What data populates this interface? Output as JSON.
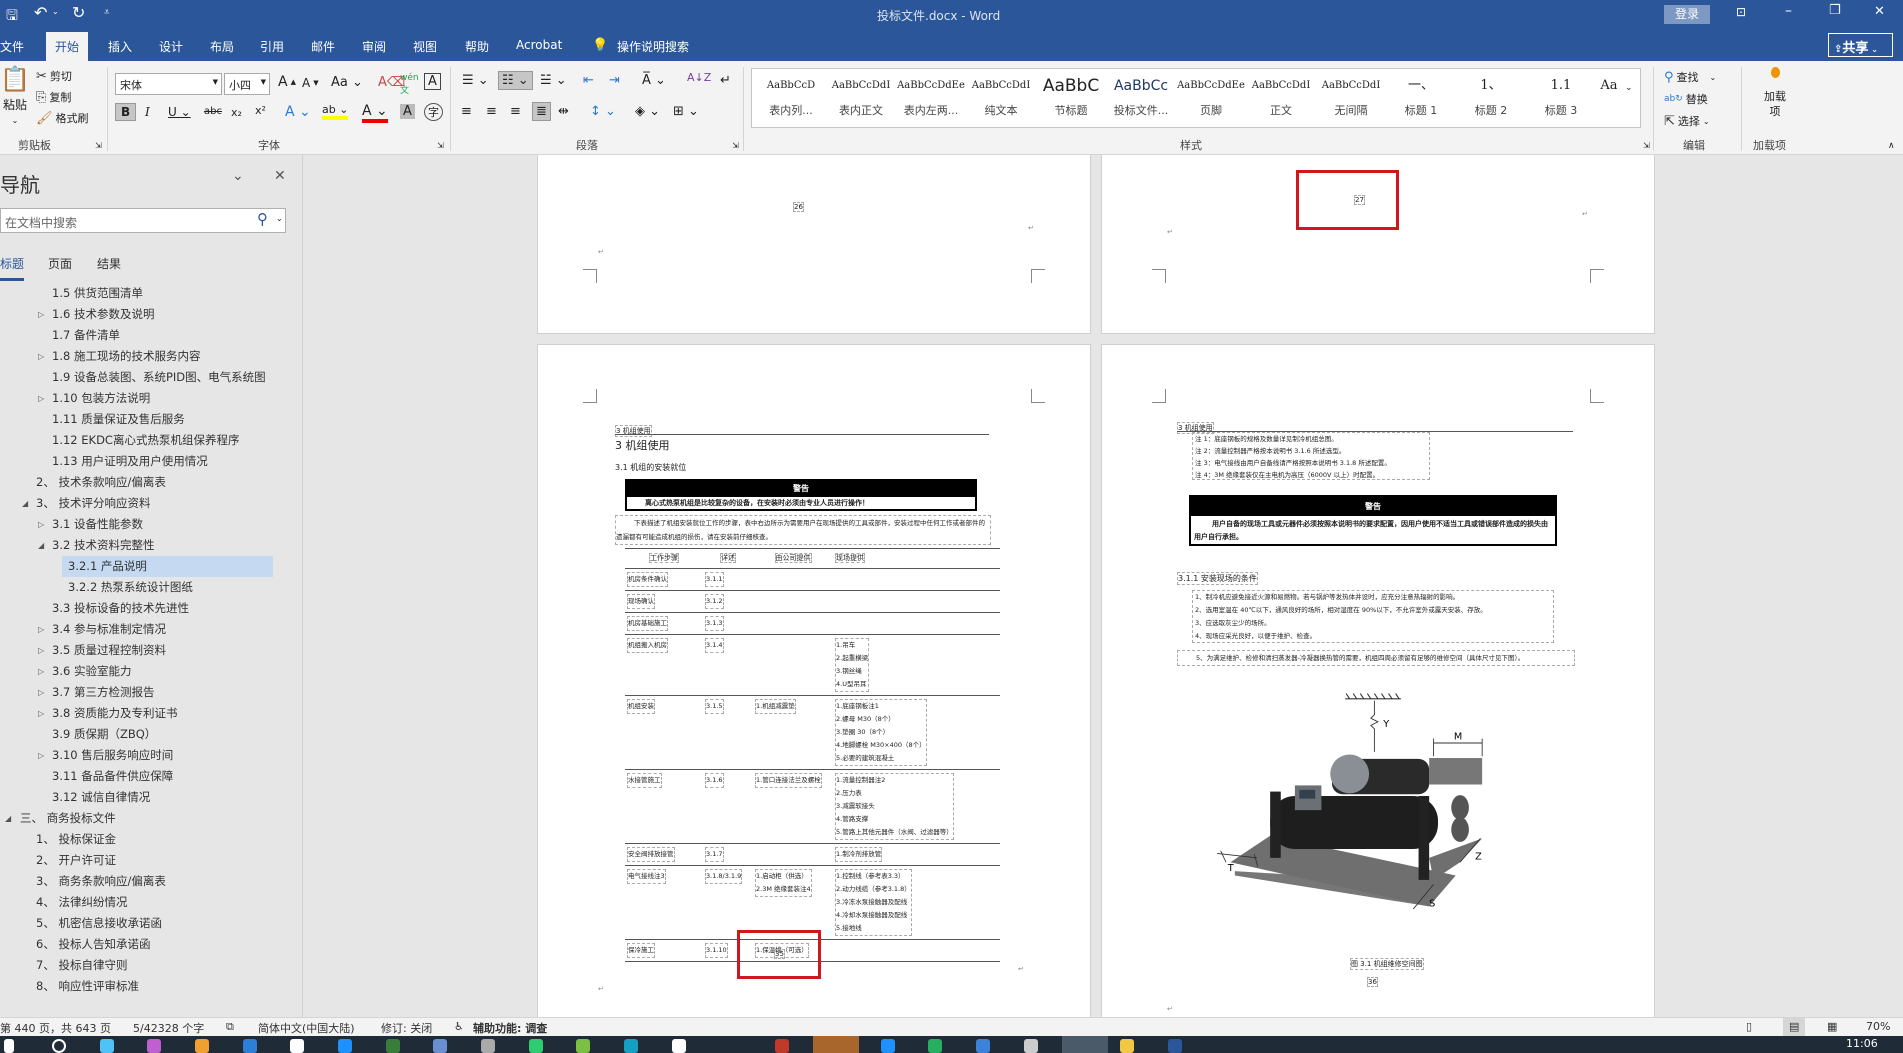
{
  "title_bar": {
    "title": "投标文件.docx  -  Word",
    "login_label": "登录",
    "share_label": "共享"
  },
  "tabs": [
    "文件",
    "开始",
    "插入",
    "设计",
    "布局",
    "引用",
    "邮件",
    "审阅",
    "视图",
    "帮助",
    "Acrobat"
  ],
  "tell_me": "操作说明搜索",
  "ribbon": {
    "clipboard": {
      "paste": "粘贴",
      "cut": "剪切",
      "copy": "复制",
      "format_painter": "格式刷",
      "label": "剪贴板"
    },
    "font": {
      "name": "宋体",
      "size": "小四",
      "label": "字体"
    },
    "paragraph": {
      "label": "段落"
    },
    "styles": {
      "label": "样式",
      "items": [
        {
          "preview": "AaBbCcD",
          "label": "表内列..."
        },
        {
          "preview": "AaBbCcDdI",
          "label": "表内正文"
        },
        {
          "preview": "AaBbCcDdEe",
          "label": "表内左两..."
        },
        {
          "preview": "AaBbCcDdI",
          "label": "纯文本"
        },
        {
          "preview": "AaBbC",
          "label": "节标题"
        },
        {
          "preview": "AaBbCc",
          "label": "投标文件..."
        },
        {
          "preview": "AaBbCcDdEe",
          "label": "页脚"
        },
        {
          "preview": "AaBbCcDdI",
          "label": "正文"
        },
        {
          "preview": "AaBbCcDdI",
          "label": "无间隔"
        },
        {
          "preview": "一、",
          "label": "标题 1"
        },
        {
          "preview": "1、",
          "label": "标题 2"
        },
        {
          "preview": "1.1",
          "label": "标题 3"
        },
        {
          "preview": "Aa",
          "label": ""
        }
      ]
    },
    "editing": {
      "find": "查找",
      "replace": "替换",
      "select": "选择",
      "label": "编辑"
    },
    "addins": {
      "button": "加载项",
      "label": "加载项"
    }
  },
  "nav": {
    "title": "导航",
    "search_placeholder": "在文档中搜索",
    "tabs": [
      "标题",
      "页面",
      "结果"
    ],
    "items": [
      {
        "text": "1.5 供货范围清单",
        "level": 2,
        "exp": ""
      },
      {
        "text": "1.6 技术参数及说明",
        "level": 2,
        "exp": "collapsed"
      },
      {
        "text": "1.7 备件清单",
        "level": 2,
        "exp": ""
      },
      {
        "text": "1.8 施工现场的技术服务内容",
        "level": 2,
        "exp": "collapsed"
      },
      {
        "text": "1.9 设备总装图、系统PID图、电气系统图",
        "level": 2,
        "exp": ""
      },
      {
        "text": "1.10 包装方法说明",
        "level": 2,
        "exp": "collapsed"
      },
      {
        "text": "1.11 质量保证及售后服务",
        "level": 2,
        "exp": ""
      },
      {
        "text": "1.12 EKDC离心式热泵机组保养程序",
        "level": 2,
        "exp": ""
      },
      {
        "text": "1.13 用户证明及用户使用情况",
        "level": 2,
        "exp": ""
      },
      {
        "text": "2、  技术条款响应/偏离表",
        "level": 1,
        "exp": ""
      },
      {
        "text": "3、  技术评分响应资料",
        "level": 1,
        "exp": "expanded"
      },
      {
        "text": "3.1 设备性能参数",
        "level": 2,
        "exp": "collapsed"
      },
      {
        "text": "3.2 技术资料完整性",
        "level": 2,
        "exp": "expanded"
      },
      {
        "text": "3.2.1 产品说明",
        "level": 3,
        "exp": "",
        "selected": true
      },
      {
        "text": "3.2.2 热泵系统设计图纸",
        "level": 3,
        "exp": ""
      },
      {
        "text": "3.3 投标设备的技术先进性",
        "level": 2,
        "exp": ""
      },
      {
        "text": "3.4 参与标准制定情况",
        "level": 2,
        "exp": "collapsed"
      },
      {
        "text": "3.5 质量过程控制资料",
        "level": 2,
        "exp": "collapsed"
      },
      {
        "text": "3.6 实验室能力",
        "level": 2,
        "exp": "collapsed"
      },
      {
        "text": "3.7 第三方检测报告",
        "level": 2,
        "exp": "collapsed"
      },
      {
        "text": "3.8 资质能力及专利证书",
        "level": 2,
        "exp": "collapsed"
      },
      {
        "text": "3.9 质保期（ZBQ）",
        "level": 2,
        "exp": ""
      },
      {
        "text": "3.10 售后服务响应时间",
        "level": 2,
        "exp": "collapsed"
      },
      {
        "text": "3.11 备品备件供应保障",
        "level": 2,
        "exp": ""
      },
      {
        "text": "3.12 诚信自律情况",
        "level": 2,
        "exp": ""
      },
      {
        "text": "三、  商务投标文件",
        "level": 0,
        "exp": "expanded"
      },
      {
        "text": "1、  投标保证金",
        "level": 1,
        "exp": ""
      },
      {
        "text": "2、  开户许可证",
        "level": 1,
        "exp": ""
      },
      {
        "text": "3、  商务条款响应/偏离表",
        "level": 1,
        "exp": ""
      },
      {
        "text": "4、  法律纠纷情况",
        "level": 1,
        "exp": ""
      },
      {
        "text": "5、  机密信息接收承诺函",
        "level": 1,
        "exp": ""
      },
      {
        "text": "6、  投标人告知承诺函",
        "level": 1,
        "exp": ""
      },
      {
        "text": "7、  投标自律守则",
        "level": 1,
        "exp": ""
      },
      {
        "text": "8、  响应性评审标准",
        "level": 1,
        "exp": ""
      }
    ]
  },
  "pages": {
    "p26": {
      "page_number": "26"
    },
    "p27": {
      "page_number": "27"
    },
    "p35": {
      "header": "3 机组使用",
      "title": "3 机组使用",
      "subtitle": "3.1 机组的安装就位",
      "warning_title": "警告",
      "warning_text": "离心式热泵机组是比较复杂的设备，在安装时必须由专业人员进行操作！",
      "intro": "下表描述了机组安装就位工作的步骤，表中右边所示为需要用户在现场提供的工具或部件，安装过程中任何工作或者部件的遗漏都有可能造成机组的损伤，请在安装前仔细核查。",
      "table_headers": [
        "工作步骤",
        "详述",
        "由公司提供",
        "现场提供"
      ],
      "table_rows": [
        [
          "机房条件确认",
          "3.1.1",
          "",
          ""
        ],
        [
          "现场确认",
          "3.1.2",
          "",
          ""
        ],
        [
          "机房基础施工",
          "3.1.3",
          "",
          ""
        ],
        [
          "机组搬入机房",
          "3.1.4",
          "",
          "1.吊车\n2.起重横梁\n3.钢丝绳\n4.U型吊耳"
        ],
        [
          "机组安装",
          "3.1.5",
          "1.机组减震垫",
          "1.底座钢板注1\n2.螺母 M30（8个）\n3.垫圈 30（8个）\n4.地脚螺栓 M30×400（8个）\n5.必要的建筑混凝土"
        ],
        [
          "水接管施工",
          "3.1.6",
          "1.管口连接法兰及螺栓",
          "1.流量控制器注2\n2.压力表\n3.减震软接头\n4.管路支撑\n5.管路上其他元器件（水阀、过滤器等）"
        ],
        [
          "安全阀排放接管",
          "3.1.7",
          "",
          "1.制冷剂排放管"
        ],
        [
          "电气接线注3",
          "3.1.8/3.1.9",
          "1.启动柜（供选）\n2.3M 绝缘套装注4",
          "1.控制线（参考表3.3）\n2.动力线缆（参考3.1.8）\n3.冷冻水泵接触器及配线\n4.冷却水泵接触器及配线\n5.接地线"
        ],
        [
          "保冷施工",
          "3.1.10",
          "1.保温棉（可选）",
          ""
        ]
      ],
      "page_number": "35"
    },
    "p36": {
      "header": "3 机组使用",
      "notes": [
        "注 1：底座钢板的规格及数量详见制冷机组总图。",
        "注 2：流量控制器严格按本说明书 3.1.6 所述选型。",
        "注 3：电气接线由用户自备线请严格按照本说明书 3.1.8 所述配置。",
        "注 4：3M 绝缘套装仅在主电机为高压（6000V 以上）时配置。"
      ],
      "warning_title": "警告",
      "warning_text": "用户自备的现场工具或元器件必须按照本说明书的要求配置，因用户使用不适当工具或错误部件造成的损失由用户自行承担。",
      "section": "3.1.1 安装现场的条件",
      "conditions": [
        "1、制冷机应避免接近火源和易燃物。若与锅炉等发热体并设时，应充分注意热辐射的影响。",
        "2、选用室温在 40℃以下，通风良好的场所，相对湿度在 90%以下，不允许室外或露天安装、存放。",
        "3、应选取灰尘少的场所。",
        "4、现场应采光良好，以便于维护、检查。"
      ],
      "condition5": "5、为满足维护、检修和清扫蒸发器-冷凝器换热管的需要，机组四周必须留有足够的维修空间（具体尺寸见下图）。",
      "figure_labels": {
        "y": "Y",
        "m": "M",
        "t": "T",
        "z": "Z",
        "s": "S"
      },
      "caption": "图 3.1  机组维修空间图",
      "page_number": "36"
    }
  },
  "status": {
    "page": "第 440 页，共 643 页",
    "words": "5/42328 个字",
    "language": "简体中文(中国大陆)",
    "track": "修订: 关闭",
    "accessibility": "辅助功能: 调查",
    "zoom": "70%"
  },
  "taskbar": {
    "time": "11:06"
  },
  "colors": {
    "accent": "#2b579a",
    "highlight_box": "#d2161e",
    "nav_selected": "#c5d9f1"
  }
}
